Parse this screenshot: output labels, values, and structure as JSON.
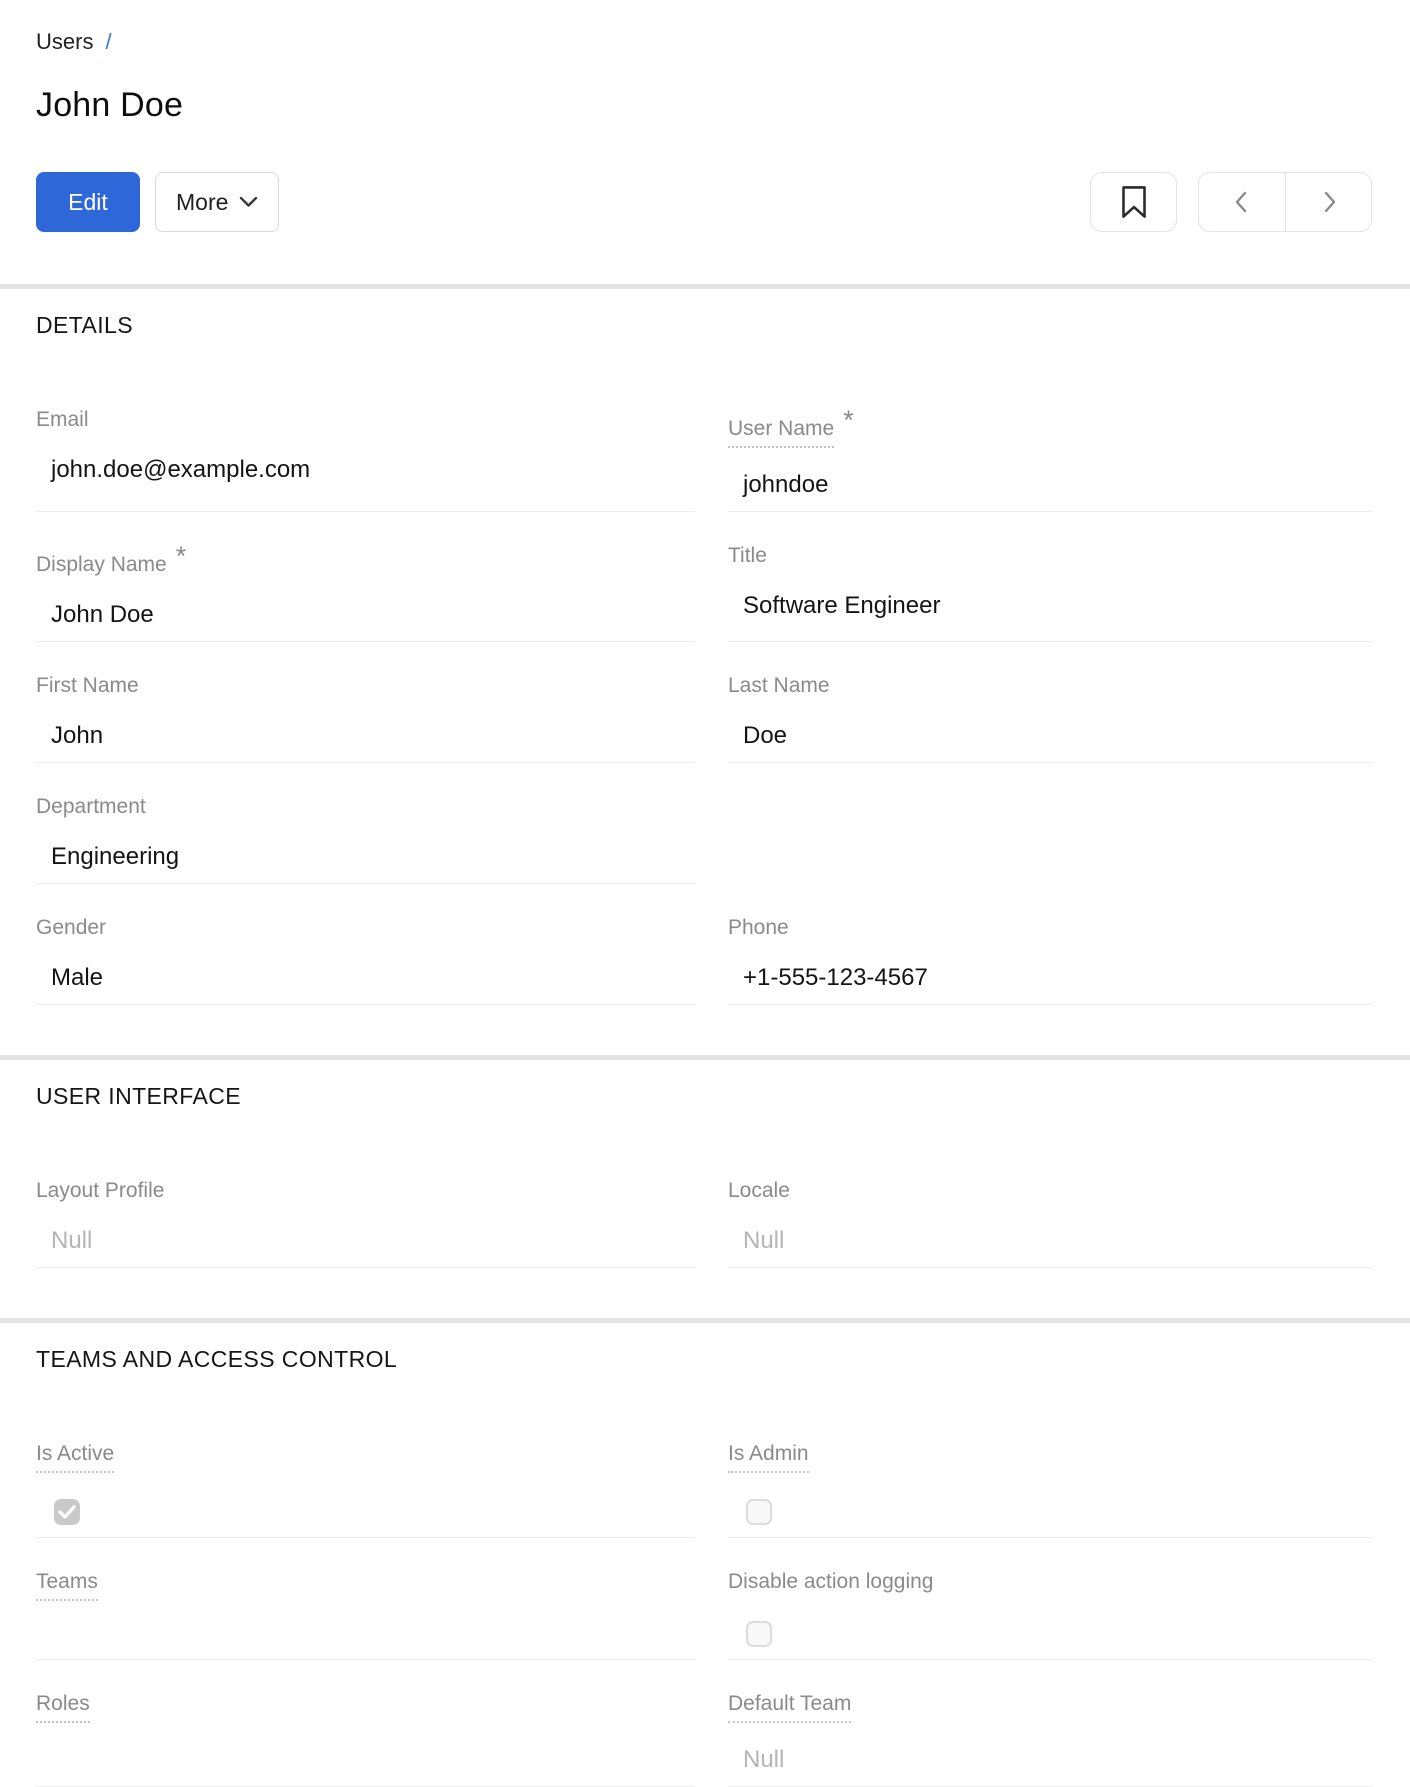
{
  "meta": {
    "required_marker": "*"
  },
  "colors": {
    "primary_button": "#2d67d8",
    "breadcrumb_separator": "#3b77e0",
    "divider": "#e3e3e3",
    "label_gray": "#8a8a8a",
    "null_value_gray": "#b5b5b5",
    "checkbox_checked_fill": "#c9c9c9"
  },
  "icons": {
    "more_button": "chevron-down",
    "bookmark_button": "bookmark",
    "previous_button": "chevron-left",
    "next_button": "chevron-right"
  },
  "breadcrumb": {
    "parent": "Users",
    "separator": "/"
  },
  "header": {
    "title": "John Doe"
  },
  "toolbar": {
    "edit": "Edit",
    "more": "More"
  },
  "sections": [
    {
      "title": "DETAILS",
      "rows": [
        [
          {
            "label": "Email",
            "value": "john.doe@example.com",
            "type": "text"
          },
          {
            "label": "User Name",
            "value": "johndoe",
            "type": "text",
            "required": true,
            "tooltip": true
          }
        ],
        [
          {
            "label": "Display Name",
            "value": "John Doe",
            "type": "text",
            "required": true
          },
          {
            "label": "Title",
            "value": "Software Engineer",
            "type": "text"
          }
        ],
        [
          {
            "label": "First Name",
            "value": "John",
            "type": "text"
          },
          {
            "label": "Last Name",
            "value": "Doe",
            "type": "text"
          }
        ],
        [
          {
            "label": "Department",
            "value": "Engineering",
            "type": "text"
          },
          null
        ],
        [
          {
            "label": "Gender",
            "value": "Male",
            "type": "text"
          },
          {
            "label": "Phone",
            "value": "+1-555-123-4567",
            "type": "text"
          }
        ]
      ]
    },
    {
      "title": "USER INTERFACE",
      "rows": [
        [
          {
            "label": "Layout Profile",
            "value": "Null",
            "type": "null"
          },
          {
            "label": "Locale",
            "value": "Null",
            "type": "null"
          }
        ]
      ]
    },
    {
      "title": "TEAMS AND ACCESS CONTROL",
      "rows": [
        [
          {
            "label": "Is Active",
            "type": "checkbox",
            "checked": true,
            "tooltip": true
          },
          {
            "label": "Is Admin",
            "type": "checkbox",
            "checked": false,
            "tooltip": true
          }
        ],
        [
          {
            "label": "Teams",
            "type": "empty",
            "tooltip": true
          },
          {
            "label": "Disable action logging",
            "type": "checkbox",
            "checked": false
          }
        ],
        [
          {
            "label": "Roles",
            "type": "empty",
            "tooltip": true
          },
          {
            "label": "Default Team",
            "value": "Null",
            "type": "null",
            "tooltip": true
          }
        ]
      ]
    }
  ]
}
